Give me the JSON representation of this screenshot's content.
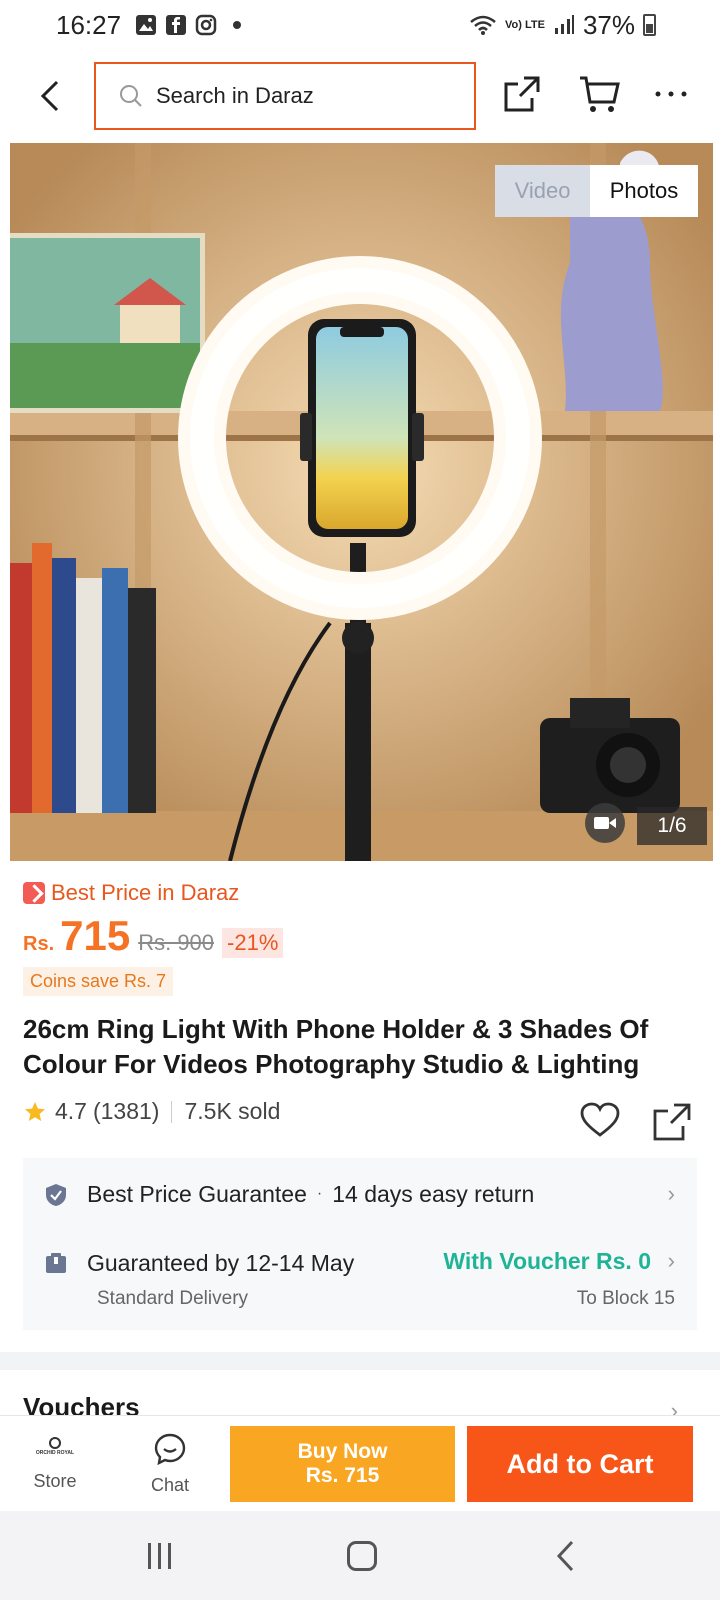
{
  "status_bar": {
    "time": "16:27",
    "battery": "37%",
    "network": "Vo) LTE"
  },
  "header": {
    "search_placeholder": "Search in Daraz"
  },
  "gallery": {
    "tabs": [
      "Video",
      "Photos"
    ],
    "active_tab": "Photos",
    "counter": "1/6"
  },
  "promo": {
    "best_price": "Best Price in Daraz"
  },
  "price": {
    "currency": "Rs.",
    "current": "715",
    "original": "Rs. 900",
    "discount": "-21%",
    "coins": "Coins save Rs. 7"
  },
  "product": {
    "title": "26cm Ring Light With Phone Holder & 3 Shades Of Colour For Videos Photography Studio & Lighting",
    "rating": "4.7",
    "rating_count": "(1381)",
    "sold": "7.5K sold"
  },
  "info": {
    "guarantee": "Best Price Guarantee",
    "returns": "14 days easy return",
    "delivery": "Guaranteed by 12-14 May",
    "delivery_type": "Standard Delivery",
    "voucher": "With Voucher Rs. 0",
    "location": "To Block 15"
  },
  "vouchers": {
    "title": "Vouchers"
  },
  "actions": {
    "store": "Store",
    "store_logo_text": "ORCHID ROYAL",
    "chat": "Chat",
    "buy_now_line1": "Buy Now",
    "buy_now_line2": "Rs. 715",
    "add_to_cart": "Add to Cart"
  },
  "colors": {
    "brand_orange": "#f57224",
    "buy_now": "#f9a722",
    "add_to_cart": "#f75618",
    "voucher_green": "#1fb496"
  }
}
